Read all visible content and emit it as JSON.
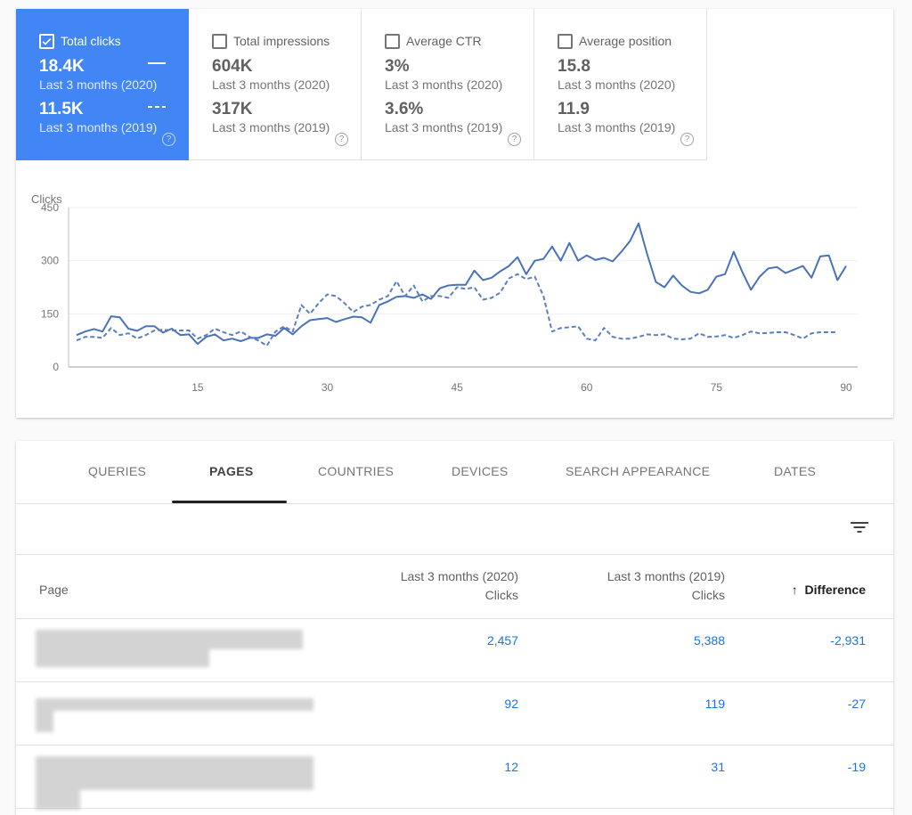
{
  "metrics": [
    {
      "label": "Total clicks",
      "checked": true,
      "value_2020": "18.4K",
      "period_2020": "Last 3 months (2020)",
      "value_2019": "11.5K",
      "period_2019": "Last 3 months (2019)",
      "help_icon": "?"
    },
    {
      "label": "Total impressions",
      "checked": false,
      "value_2020": "604K",
      "period_2020": "Last 3 months (2020)",
      "value_2019": "317K",
      "period_2019": "Last 3 months (2019)",
      "help_icon": "?"
    },
    {
      "label": "Average CTR",
      "checked": false,
      "value_2020": "3%",
      "period_2020": "Last 3 months (2020)",
      "value_2019": "3.6%",
      "period_2019": "Last 3 months (2019)",
      "help_icon": "?"
    },
    {
      "label": "Average position",
      "checked": false,
      "value_2020": "15.8",
      "period_2020": "Last 3 months (2020)",
      "value_2019": "11.9",
      "period_2019": "Last 3 months (2019)",
      "help_icon": "?"
    }
  ],
  "colors": {
    "accent": "#4285f4",
    "line": "#4a72b8",
    "link": "#1a73e8"
  },
  "chart_data": {
    "type": "line",
    "title": "",
    "ylabel": "Clicks",
    "xlabel": "",
    "ylim": [
      0,
      450
    ],
    "xlim": [
      1,
      90
    ],
    "yticks": [
      0,
      150,
      300,
      450
    ],
    "xticks": [
      15,
      30,
      45,
      60,
      75,
      90
    ],
    "grid": true,
    "series": [
      {
        "name": "Last 3 months (2020)",
        "style": "solid",
        "x": [
          1,
          2,
          3,
          4,
          5,
          6,
          7,
          8,
          9,
          10,
          11,
          12,
          13,
          14,
          15,
          16,
          17,
          18,
          19,
          20,
          21,
          22,
          23,
          24,
          25,
          26,
          27,
          28,
          29,
          30,
          31,
          32,
          33,
          34,
          35,
          36,
          37,
          38,
          39,
          40,
          41,
          42,
          43,
          44,
          45,
          46,
          47,
          48,
          49,
          50,
          51,
          52,
          53,
          54,
          55,
          56,
          57,
          58,
          59,
          60,
          61,
          62,
          63,
          64,
          65,
          66,
          67,
          68,
          69,
          70,
          71,
          72,
          73,
          74,
          75,
          76,
          77,
          78,
          79,
          80,
          81,
          82,
          83,
          84,
          85,
          86,
          87,
          88,
          89,
          90
        ],
        "values": [
          90,
          100,
          107,
          100,
          143,
          140,
          108,
          102,
          115,
          115,
          97,
          108,
          90,
          92,
          65,
          85,
          92,
          75,
          80,
          73,
          82,
          82,
          92,
          88,
          110,
          92,
          115,
          132,
          135,
          138,
          127,
          135,
          142,
          140,
          125,
          175,
          185,
          198,
          200,
          195,
          205,
          192,
          222,
          230,
          232,
          232,
          272,
          245,
          252,
          270,
          285,
          310,
          262,
          300,
          305,
          340,
          300,
          350,
          300,
          315,
          302,
          308,
          298,
          325,
          355,
          405,
          318,
          240,
          225,
          258,
          230,
          212,
          208,
          218,
          255,
          262,
          325,
          268,
          218,
          255,
          278,
          282,
          265,
          275,
          285,
          252,
          312,
          315,
          245,
          285,
          268
        ],
        "note": "x=1..90 days; 91 points listed—last value unused"
      },
      {
        "name": "Last 3 months (2019)",
        "style": "dashed",
        "x": [
          1,
          2,
          3,
          4,
          5,
          6,
          7,
          8,
          9,
          10,
          11,
          12,
          13,
          14,
          15,
          16,
          17,
          18,
          19,
          20,
          21,
          22,
          23,
          24,
          25,
          26,
          27,
          28,
          29,
          30,
          31,
          32,
          33,
          34,
          35,
          36,
          37,
          38,
          39,
          40,
          41,
          42,
          43,
          44,
          45,
          46,
          47,
          48,
          49,
          50,
          51,
          52,
          53,
          54,
          55,
          56,
          57,
          58,
          59,
          60,
          61,
          62,
          63,
          64,
          65,
          66,
          67,
          68,
          69,
          70,
          71,
          72,
          73,
          74,
          75,
          76,
          77,
          78,
          79,
          80,
          81,
          82,
          83,
          84,
          85,
          86,
          87,
          88,
          89
        ],
        "values": [
          75,
          85,
          85,
          82,
          110,
          90,
          95,
          80,
          90,
          103,
          105,
          103,
          103,
          103,
          80,
          90,
          108,
          98,
          90,
          100,
          85,
          75,
          60,
          100,
          115,
          100,
          175,
          150,
          180,
          205,
          200,
          180,
          155,
          170,
          175,
          190,
          200,
          242,
          200,
          230,
          185,
          200,
          200,
          195,
          225,
          220,
          225,
          190,
          195,
          210,
          250,
          262,
          248,
          255,
          200,
          100,
          110,
          112,
          115,
          80,
          75,
          110,
          85,
          80,
          80,
          85,
          92,
          90,
          92,
          80,
          78,
          80,
          95,
          85,
          86,
          90,
          82,
          90,
          100,
          95,
          96,
          98,
          98,
          90,
          80,
          95,
          98,
          98,
          98
        ],
        "note": "x=1..89"
      }
    ]
  },
  "tabs": [
    {
      "label": "QUERIES",
      "active": false
    },
    {
      "label": "PAGES",
      "active": true
    },
    {
      "label": "COUNTRIES",
      "active": false
    },
    {
      "label": "DEVICES",
      "active": false
    },
    {
      "label": "SEARCH APPEARANCE",
      "active": false
    },
    {
      "label": "DATES",
      "active": false
    }
  ],
  "table": {
    "filter_icon": "filter-icon",
    "columns": {
      "page": "Page",
      "c2020_line1": "Last 3 months (2020)",
      "c2020_line2": "Clicks",
      "c2019_line1": "Last 3 months (2019)",
      "c2019_line2": "Clicks",
      "diff_arrow": "↑",
      "diff": "Difference"
    },
    "rows": [
      {
        "page": "[redacted]",
        "clicks_2020": "2,457",
        "clicks_2019": "5,388",
        "difference": "-2,931"
      },
      {
        "page": "[redacted]",
        "clicks_2020": "92",
        "clicks_2019": "119",
        "difference": "-27"
      },
      {
        "page": "[redacted]",
        "clicks_2020": "12",
        "clicks_2019": "31",
        "difference": "-19"
      }
    ]
  }
}
